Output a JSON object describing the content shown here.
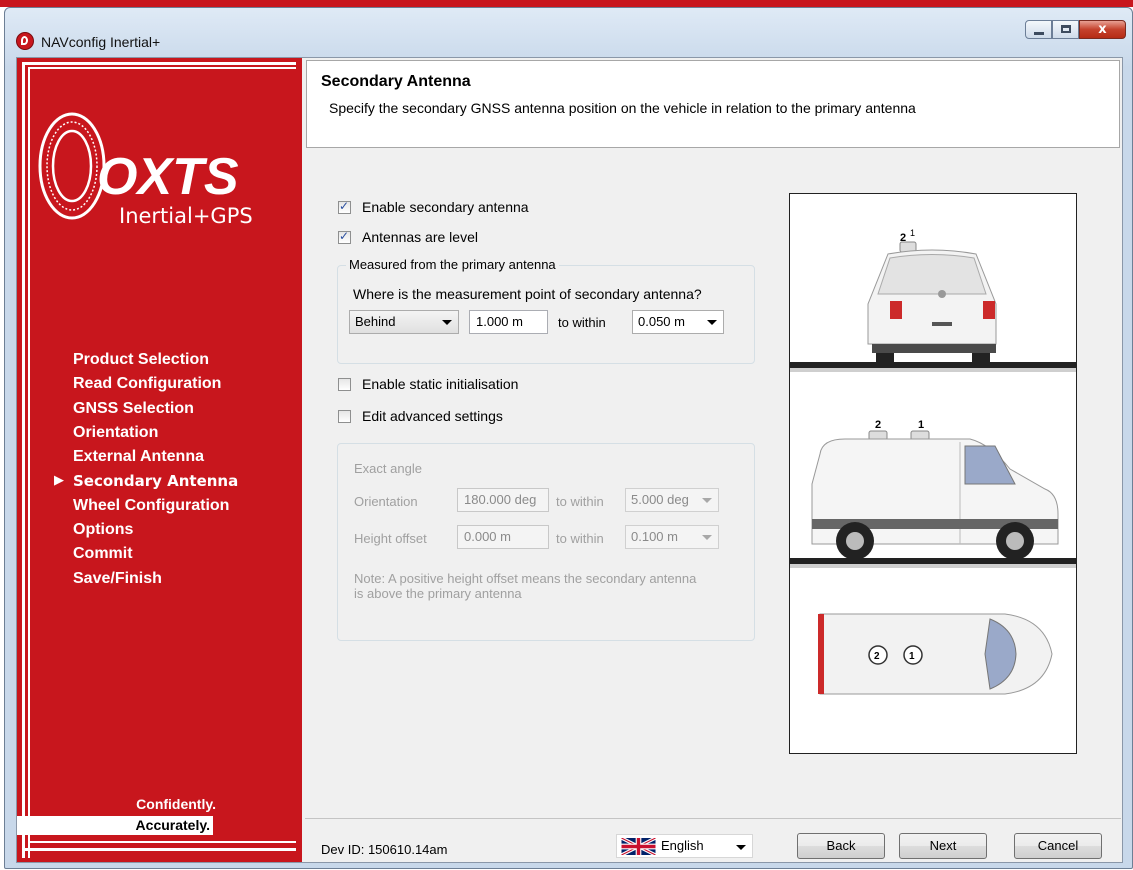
{
  "window": {
    "title": "NAVconfig Inertial+",
    "controls": {
      "minimize": "minimize-icon",
      "maximize": "maximize-icon",
      "close": "close-icon",
      "close_glyph": "x"
    }
  },
  "sidebar": {
    "logo": {
      "brand": "OXTS",
      "tagline": "Inertial+GPS"
    },
    "items": [
      {
        "label": "Product Selection",
        "active": false
      },
      {
        "label": "Read Configuration",
        "active": false
      },
      {
        "label": "GNSS Selection",
        "active": false
      },
      {
        "label": "Orientation",
        "active": false
      },
      {
        "label": "External Antenna",
        "active": false
      },
      {
        "label": "Secondary Antenna",
        "active": true
      },
      {
        "label": "Wheel Configuration",
        "active": false
      },
      {
        "label": "Options",
        "active": false
      },
      {
        "label": "Commit",
        "active": false
      },
      {
        "label": "Save/Finish",
        "active": false
      }
    ],
    "active_marker": "▶",
    "slogan_1": "Confidently.",
    "slogan_2": "Accurately."
  },
  "header": {
    "title": "Secondary Antenna",
    "subtitle": "Specify the secondary GNSS antenna position on the vehicle in relation to the primary antenna"
  },
  "form": {
    "enable_secondary": {
      "label": "Enable secondary antenna",
      "checked": true
    },
    "antennas_level": {
      "label": "Antennas are level",
      "checked": true
    },
    "measured_group": {
      "legend": "Measured from the primary antenna",
      "question": "Where is the measurement point of secondary antenna?",
      "direction": "Behind",
      "distance": "1.000 m",
      "to_within": "to within",
      "accuracy": "0.050 m"
    },
    "static_init": {
      "label": "Enable static initialisation",
      "checked": false
    },
    "advanced": {
      "label": "Edit advanced settings",
      "checked": false
    },
    "advanced_group": {
      "heading": "Exact angle",
      "orientation_label": "Orientation",
      "orientation_value": "180.000 deg",
      "orientation_within": "to within",
      "orientation_accuracy": "5.000 deg",
      "height_label": "Height offset",
      "height_value": "0.000 m",
      "height_within": "to within",
      "height_accuracy": "0.100 m",
      "note": "Note: A positive height offset means the secondary antenna is above the primary antenna"
    }
  },
  "diagram": {
    "rear_labels": [
      "2",
      "1"
    ],
    "side_labels": [
      "2",
      "1"
    ],
    "top_labels": [
      "2",
      "1"
    ]
  },
  "footer": {
    "dev_id": "Dev ID: 150610.14am",
    "language": "English",
    "back": "Back",
    "next": "Next",
    "cancel": "Cancel"
  },
  "colors": {
    "brand_red": "#c8161d",
    "panel_bg": "#f0f0f0"
  }
}
